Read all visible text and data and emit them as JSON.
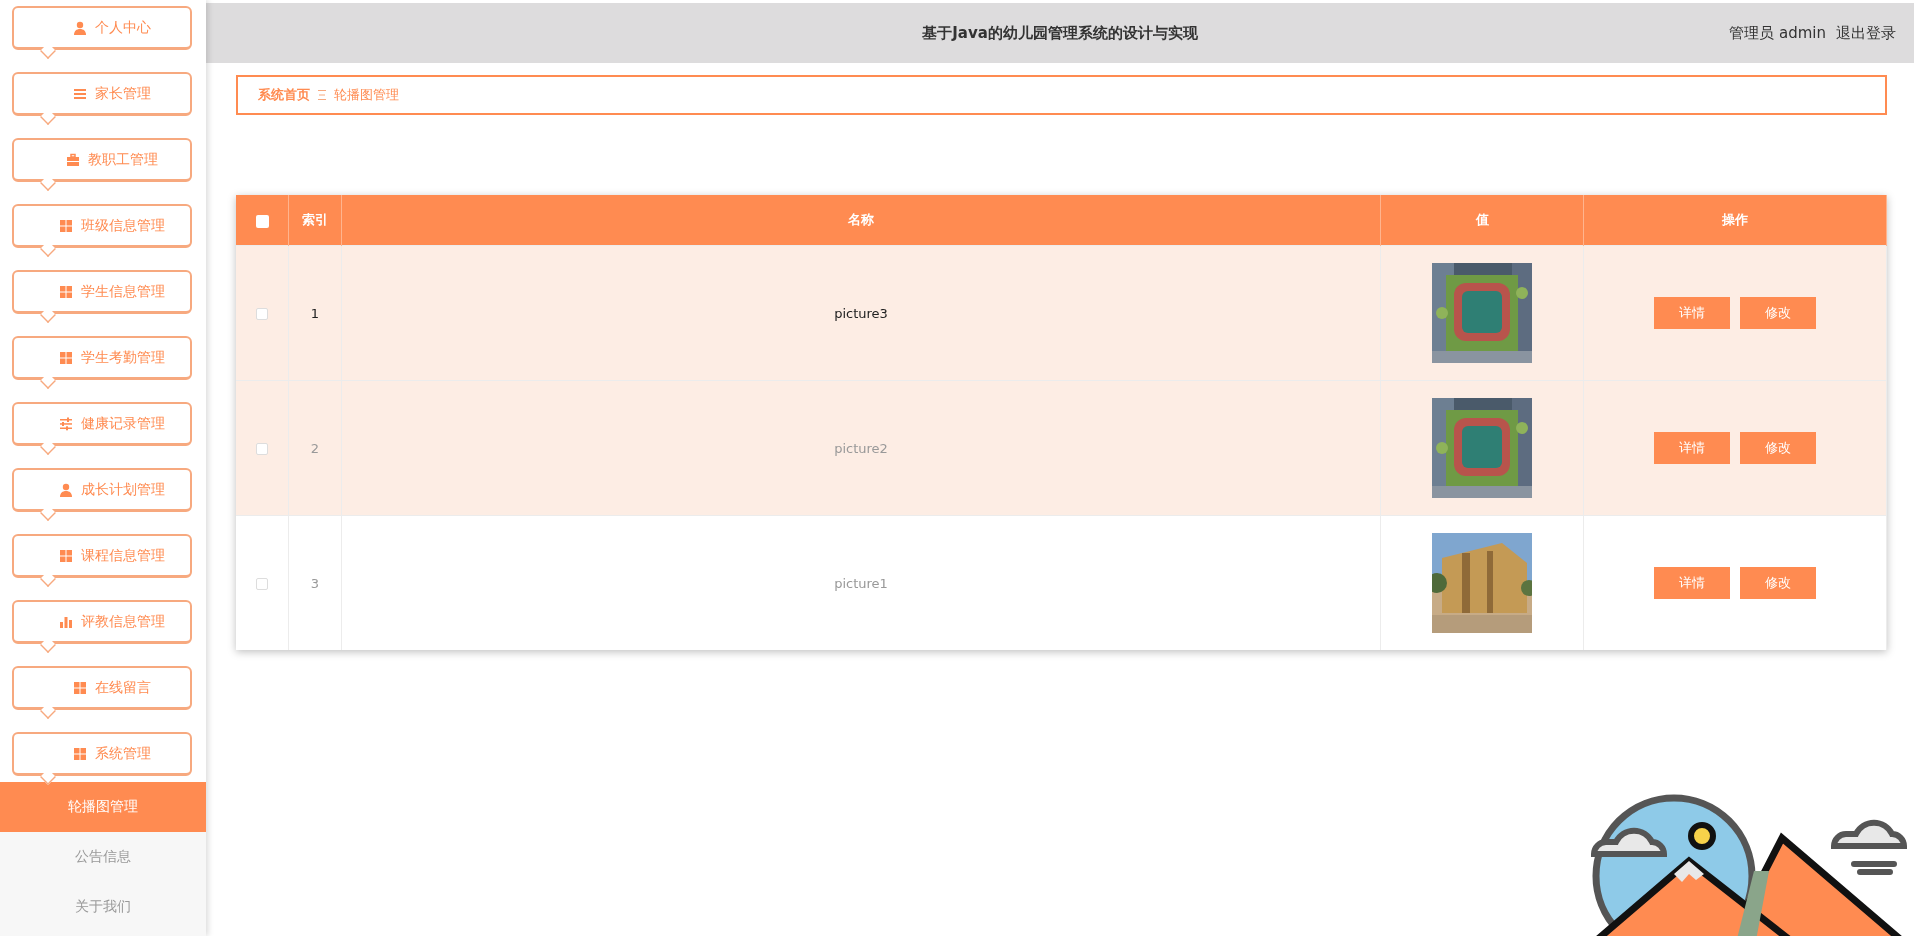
{
  "sidebar": {
    "items": [
      {
        "label": "个人中心"
      },
      {
        "label": "家长管理"
      },
      {
        "label": "教职工管理"
      },
      {
        "label": "班级信息管理"
      },
      {
        "label": "学生信息管理"
      },
      {
        "label": "学生考勤管理"
      },
      {
        "label": "健康记录管理"
      },
      {
        "label": "成长计划管理"
      },
      {
        "label": "课程信息管理"
      },
      {
        "label": "评教信息管理"
      },
      {
        "label": "在线留言"
      },
      {
        "label": "系统管理",
        "expanded": true,
        "children": [
          {
            "label": "轮播图管理",
            "selected": true
          },
          {
            "label": "公告信息",
            "selected": false
          },
          {
            "label": "关于我们",
            "selected": false
          }
        ]
      }
    ]
  },
  "header": {
    "title": "基于Java的幼儿园管理系统的设计与实现",
    "user": "管理员 admin",
    "logout": "退出登录"
  },
  "breadcrumb": {
    "home": "系统首页",
    "current": "轮播图管理"
  },
  "table": {
    "columns": [
      "索引",
      "名称",
      "值",
      "操作"
    ],
    "select_all": {
      "checked": false
    },
    "rows": [
      {
        "index": "1",
        "name": "picture3",
        "value": {
          "kind": "picture"
        },
        "checked": false,
        "striped": true,
        "hovered": true,
        "actions": [
          "详情",
          "修改"
        ]
      },
      {
        "index": "2",
        "name": "picture2",
        "value": {
          "kind": "picture"
        },
        "checked": false,
        "striped": true,
        "hovered": false,
        "actions": [
          "详情",
          "修改"
        ]
      },
      {
        "index": "3",
        "name": "picture1",
        "value": {
          "kind": "picture"
        },
        "checked": false,
        "striped": false,
        "hovered": false,
        "actions": [
          "详情",
          "修改"
        ]
      }
    ]
  }
}
